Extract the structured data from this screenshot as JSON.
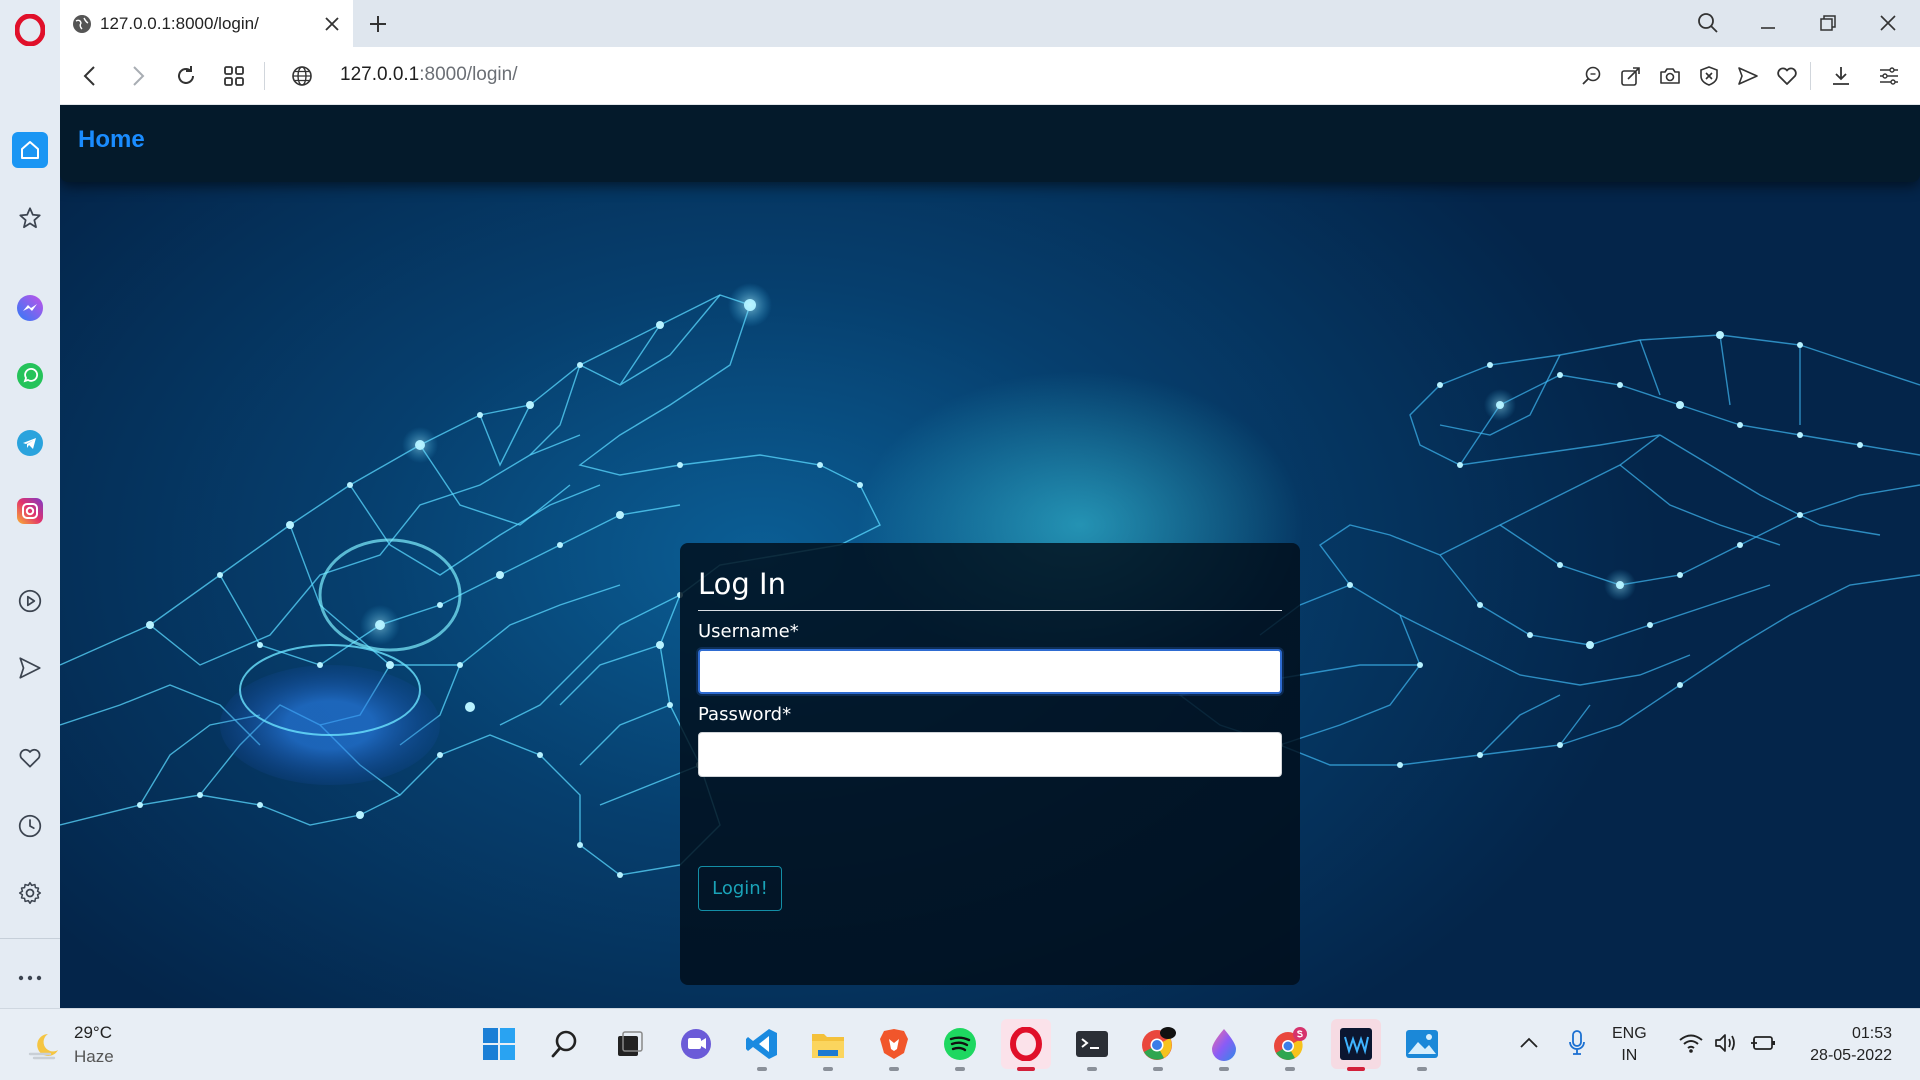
{
  "browser": {
    "tab_title": "127.0.0.1:8000/login/",
    "url_host": "127.0.0.1",
    "url_path": ":8000/login/"
  },
  "page": {
    "nav_home": "Home",
    "login": {
      "title": "Log In",
      "username_label": "Username*",
      "username_value": "",
      "password_label": "Password*",
      "password_value": "",
      "submit_label": "Login!"
    }
  },
  "taskbar": {
    "weather_temp": "29°C",
    "weather_desc": "Haze",
    "language_top": "ENG",
    "language_bottom": "IN",
    "time": "01:53",
    "date": "28-05-2022"
  },
  "colors": {
    "opera_red": "#e0102a",
    "link_blue": "#1a8cff",
    "accent_teal": "#1aa3b8",
    "sidebar_active": "#1b96f3"
  }
}
